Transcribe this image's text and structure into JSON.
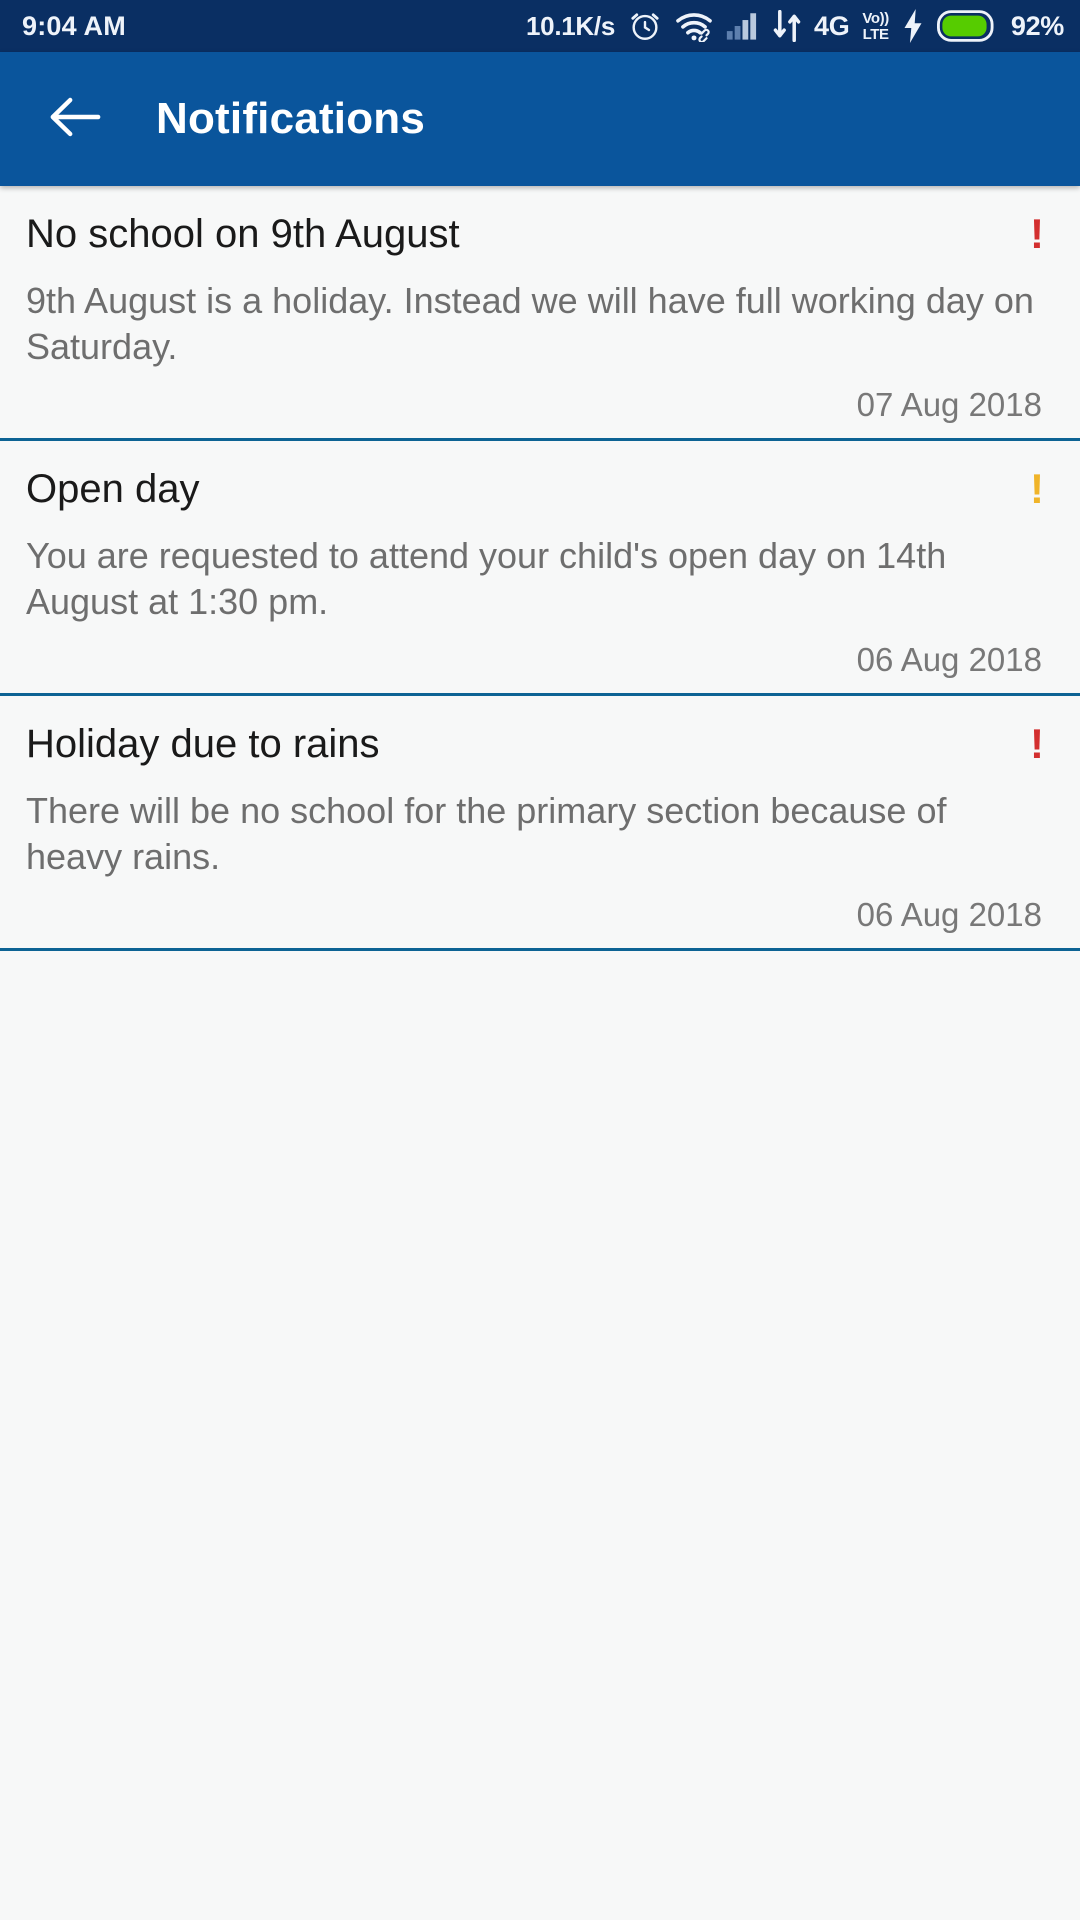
{
  "status_bar": {
    "time": "9:04 AM",
    "network_speed": "10.1K/s",
    "alarm_icon": "alarm-clock-icon",
    "wifi_icon": "wifi-icon",
    "signal_icon": "cellular-signal-icon",
    "data_transfer_icon": "data-transfer-arrows-icon",
    "network_type": "4G",
    "volte_top": "Vo))",
    "volte_bottom": "LTE",
    "charging_icon": "charging-bolt-icon",
    "battery_percent": "92%",
    "background_color": "#0a2f63",
    "text_color": "#eef3fa",
    "battery_fill_color": "#56cc00"
  },
  "app_bar": {
    "back_icon": "back-arrow-icon",
    "title": "Notifications",
    "background_color": "#0a559c",
    "text_color": "#ffffff"
  },
  "notifications": [
    {
      "title": "No school on 9th August",
      "body": "9th August is a holiday. Instead we will have full working day on Saturday.",
      "date": "07 Aug 2018",
      "priority": "!",
      "priority_level": "high",
      "priority_color": "#d32f2f"
    },
    {
      "title": "Open day",
      "body": "You are requested to attend your child's open day on 14th August at 1:30 pm.",
      "date": "06 Aug 2018",
      "priority": "!",
      "priority_level": "medium",
      "priority_color": "#f0b429"
    },
    {
      "title": "Holiday due to rains",
      "body": "There will be no school for the primary section because of heavy rains.",
      "date": "06 Aug 2018",
      "priority": "!",
      "priority_level": "high",
      "priority_color": "#d32f2f"
    }
  ],
  "theme": {
    "page_background": "#f7f8f8",
    "divider_color": "#0d6394",
    "title_color": "#1a1a1a",
    "body_color": "#6e6e6e",
    "date_color": "#787878"
  }
}
